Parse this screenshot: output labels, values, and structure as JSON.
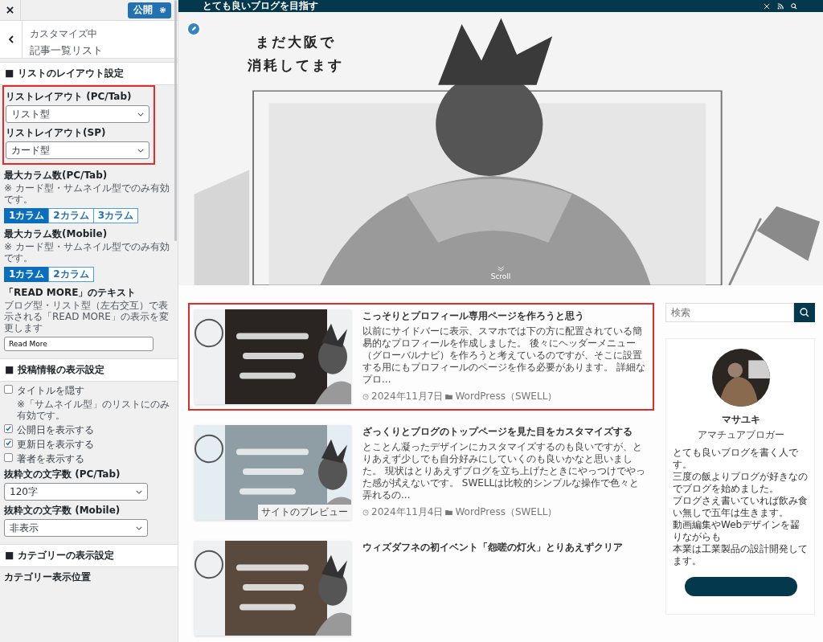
{
  "customizer": {
    "publish_button": "公開",
    "breadcrumb": "カスタマイズ中",
    "title": "記事一覧リスト",
    "sections": [
      {
        "title": "■ リストのレイアウト設定",
        "controls": [
          {
            "kind": "group",
            "highlighted": true,
            "controls": [
              {
                "kind": "select",
                "label": "リストレイアウト (PC/Tab)",
                "value": "リスト型"
              },
              {
                "kind": "select",
                "label": "リストレイアウト(SP)",
                "value": "カード型"
              }
            ]
          },
          {
            "kind": "buttons",
            "label": "最大カラム数(PC/Tab)",
            "note": "※ カード型・サムネイル型でのみ有効です。",
            "options": [
              {
                "label": "1カラム",
                "selected": true
              },
              {
                "label": "2カラム",
                "selected": false
              },
              {
                "label": "3カラム",
                "selected": false
              }
            ]
          },
          {
            "kind": "buttons",
            "label": "最大カラム数(Mobile)",
            "note": "※ カード型・サムネイル型でのみ有効です。",
            "options": [
              {
                "label": "1カラム",
                "selected": true
              },
              {
                "label": "2カラム",
                "selected": false
              }
            ]
          },
          {
            "kind": "text",
            "label": "「READ MORE」のテキスト",
            "description": "ブログ型・リスト型（左右交互）で表示される「READ MORE」の表示を変更します",
            "value": "Read More"
          }
        ]
      },
      {
        "title": "■ 投稿情報の表示設定",
        "controls": [
          {
            "kind": "checkbox",
            "label": "タイトルを隠す",
            "note": "※「サムネイル型」のリストにのみ有効です。",
            "checked": false
          },
          {
            "kind": "checkbox",
            "label": "公開日を表示する",
            "checked": true
          },
          {
            "kind": "checkbox",
            "label": "更新日を表示する",
            "checked": true
          },
          {
            "kind": "checkbox",
            "label": "著者を表示する",
            "checked": false
          },
          {
            "kind": "select",
            "label": "抜粋文の文字数 (PC/Tab)",
            "value": "120字"
          },
          {
            "kind": "select",
            "label": "抜粋文の文字数 (Mobile)",
            "value": "非表示"
          }
        ]
      },
      {
        "title": "■ カテゴリーの表示設定",
        "controls": [
          {
            "kind": "heading",
            "label": "カテゴリー表示位置"
          }
        ]
      }
    ]
  },
  "preview": {
    "tagline": "とても良いブログを目指す",
    "logo": [
      "まだ大阪で",
      "消耗してます"
    ],
    "scroll_label": "Scroll",
    "posts": [
      {
        "title": "こっそりとプロフィール専用ページを作ろうと思う",
        "excerpt": "以前にサイドバーに表示、スマホでは下の方に配置されている簡易的なプロフィールを作成しました。 後々にヘッダーメニュー（グローバルナビ）を作ろうと考えているのですが、そこに設置する用にもプロフィールのページを作る必要があります。 詳細なプロ...",
        "date": "2024年11月7日",
        "category": "WordPress（SWELL）",
        "highlighted": true
      },
      {
        "title": "ざっくりとブログのトップページを見た目をカスタマイズする",
        "excerpt": "とことん凝ったデザインにカスタマイズするのも良いですが、とりあえず少しでも自分好みにしていくのも良いかなと思いました。 現状はとりあえずブログを立ち上げたときにやっつけでやった感が拭えないです。 SWELLは比較的シンプルな操作で色々と弄れるの...",
        "date": "2024年11月4日",
        "category": "WordPress（SWELL）",
        "highlighted": false,
        "tooltip": "サイトのプレビュー"
      },
      {
        "title": "ウィズダフネの初イベント「怨嗟の灯火」とりあえずクリア",
        "highlighted": false
      }
    ],
    "search": {
      "placeholder": "検索"
    },
    "profile": {
      "name": "マサユキ",
      "role": "アマチュアブロガー",
      "bio": [
        "とても良いブログを書く人です。",
        "三度の飯よりブログが好きなのでブログを始めました。",
        "ブログさえ書いていれば飲み食い無しで五年は生きます。",
        "動画編集やWebデザインを齧りながらも",
        "本業は工業製品の設計開発してます。"
      ]
    }
  }
}
